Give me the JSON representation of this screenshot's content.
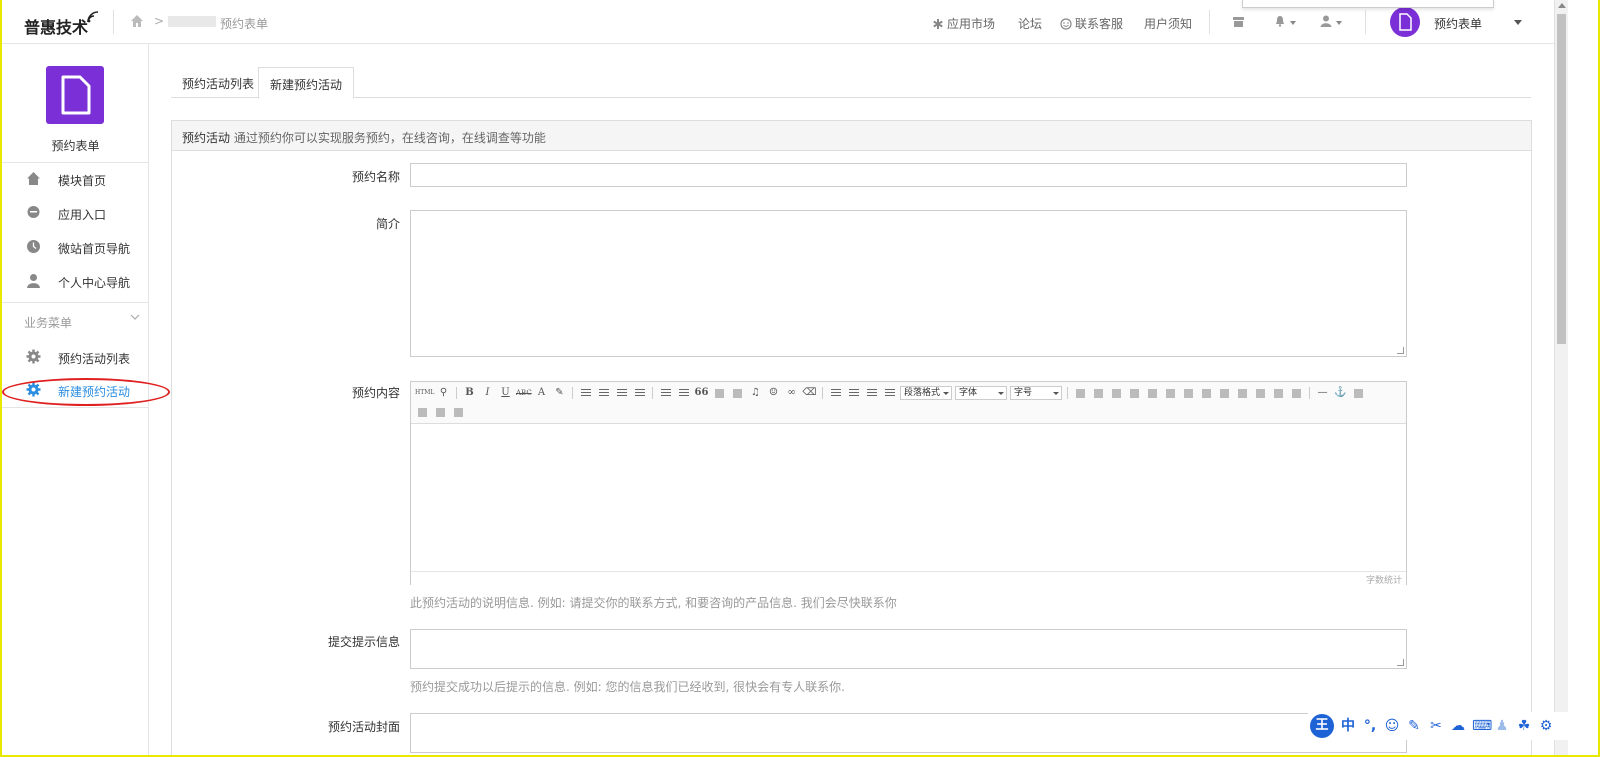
{
  "header": {
    "logo_text": "普惠技术",
    "breadcrumb_current": "预约表单",
    "nav": {
      "app_market": "应用市场",
      "forum": "论坛",
      "customer_service": "联系客服",
      "user_notice": "用户须知"
    },
    "account_name": "预约表单"
  },
  "sidebar": {
    "module_title": "预约表单",
    "items": [
      {
        "label": "模块首页",
        "icon": "home-icon"
      },
      {
        "label": "应用入口",
        "icon": "chat-bubble-icon"
      },
      {
        "label": "微站首页导航",
        "icon": "clock-icon"
      },
      {
        "label": "个人中心导航",
        "icon": "user-icon"
      }
    ],
    "group_label": "业务菜单",
    "business_items": [
      {
        "label": "预约活动列表",
        "icon": "gear-icon",
        "active": false
      },
      {
        "label": "新建预约活动",
        "icon": "gear-icon",
        "active": true
      }
    ]
  },
  "tabs": [
    {
      "label": "预约活动列表",
      "active": false
    },
    {
      "label": "新建预约活动",
      "active": true
    }
  ],
  "panel": {
    "head_title": "预约活动",
    "head_desc": "通过预约你可以实现服务预约，在线咨询，在线调查等功能"
  },
  "form": {
    "name_label": "预约名称",
    "name_value": "",
    "intro_label": "简介",
    "intro_value": "",
    "content_label": "预约内容",
    "content_help": "此预约活动的说明信息. 例如: 请提交你的联系方式, 和要咨询的产品信息. 我们会尽快联系你",
    "submit_tip_label": "提交提示信息",
    "submit_tip_value": "",
    "submit_tip_help": "预约提交成功以后提示的信息. 例如: 您的信息我们已经收到, 很快会有专人联系你.",
    "cover_label": "预约活动封面"
  },
  "editor": {
    "paragraph_format": "段落格式",
    "font_family": "字体",
    "font_size": "字号",
    "word_count": "字数统计",
    "html_label": "HTML",
    "bold": "B",
    "italic": "I",
    "underline": "U",
    "strike": "ABC",
    "font_color": "A",
    "quote": "66"
  },
  "ime": {
    "logo": "王",
    "mode": "中"
  },
  "colors": {
    "accent": "#2b8de0",
    "brand_purple": "#7b2fd6",
    "highlight_red": "#e02020"
  }
}
